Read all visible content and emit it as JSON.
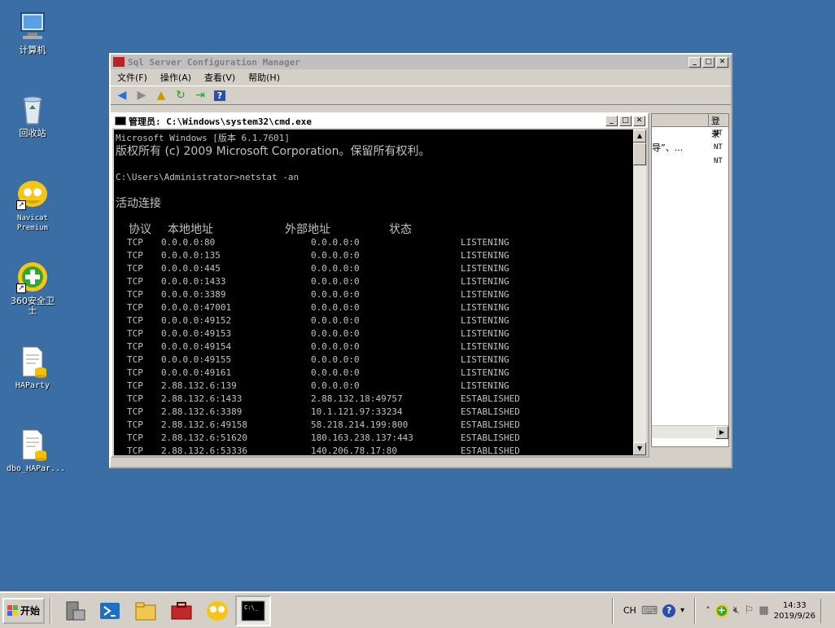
{
  "desktop": {
    "icons": [
      {
        "label": "计算机"
      },
      {
        "label": "回收站"
      },
      {
        "label": "Navicat\nPremium"
      },
      {
        "label": "360安全卫士"
      },
      {
        "label": "HAParty"
      },
      {
        "label": "dbo_HAPar..."
      }
    ]
  },
  "sql_window": {
    "title": "Sql Server Configuration Manager",
    "menu": [
      "文件(F)",
      "操作(A)",
      "查看(V)",
      "帮助(H)"
    ],
    "right_pane": {
      "header": "登录",
      "partial_text": "导”、...",
      "nt_values": [
        "NT",
        "NT",
        "NT"
      ]
    }
  },
  "cmd_window": {
    "title": "管理员: C:\\Windows\\system32\\cmd.exe",
    "lines": {
      "l1": "Microsoft Windows [版本 6.1.7601]",
      "l2": "版权所有 (c) 2009 Microsoft Corporation。保留所有权利。",
      "l3": "C:\\Users\\Administrator>netstat -an",
      "l4": "活动连接"
    },
    "headers": [
      "协议",
      "本地地址",
      "外部地址",
      "状态"
    ],
    "connections": [
      [
        "TCP",
        "0.0.0.0:80",
        "0.0.0.0:0",
        "LISTENING"
      ],
      [
        "TCP",
        "0.0.0.0:135",
        "0.0.0.0:0",
        "LISTENING"
      ],
      [
        "TCP",
        "0.0.0.0:445",
        "0.0.0.0:0",
        "LISTENING"
      ],
      [
        "TCP",
        "0.0.0.0:1433",
        "0.0.0.0:0",
        "LISTENING"
      ],
      [
        "TCP",
        "0.0.0.0:3389",
        "0.0.0.0:0",
        "LISTENING"
      ],
      [
        "TCP",
        "0.0.0.0:47001",
        "0.0.0.0:0",
        "LISTENING"
      ],
      [
        "TCP",
        "0.0.0.0:49152",
        "0.0.0.0:0",
        "LISTENING"
      ],
      [
        "TCP",
        "0.0.0.0:49153",
        "0.0.0.0:0",
        "LISTENING"
      ],
      [
        "TCP",
        "0.0.0.0:49154",
        "0.0.0.0:0",
        "LISTENING"
      ],
      [
        "TCP",
        "0.0.0.0:49155",
        "0.0.0.0:0",
        "LISTENING"
      ],
      [
        "TCP",
        "0.0.0.0:49161",
        "0.0.0.0:0",
        "LISTENING"
      ],
      [
        "TCP",
        "2.88.132.6:139",
        "0.0.0.0:0",
        "LISTENING"
      ],
      [
        "TCP",
        "2.88.132.6:1433",
        "2.88.132.18:49757",
        "ESTABLISHED"
      ],
      [
        "TCP",
        "2.88.132.6:3389",
        "10.1.121.97:33234",
        "ESTABLISHED"
      ],
      [
        "TCP",
        "2.88.132.6:49158",
        "58.218.214.199:800",
        "ESTABLISHED"
      ],
      [
        "TCP",
        "2.88.132.6:51620",
        "180.163.238.137:443",
        "ESTABLISHED"
      ],
      [
        "TCP",
        "2.88.132.6:53336",
        "140.206.78.17:80",
        "ESTABLISHED"
      ]
    ]
  },
  "taskbar": {
    "start_label": "开始",
    "lang": "CH",
    "time": "14:33",
    "date": "2019/9/26"
  }
}
